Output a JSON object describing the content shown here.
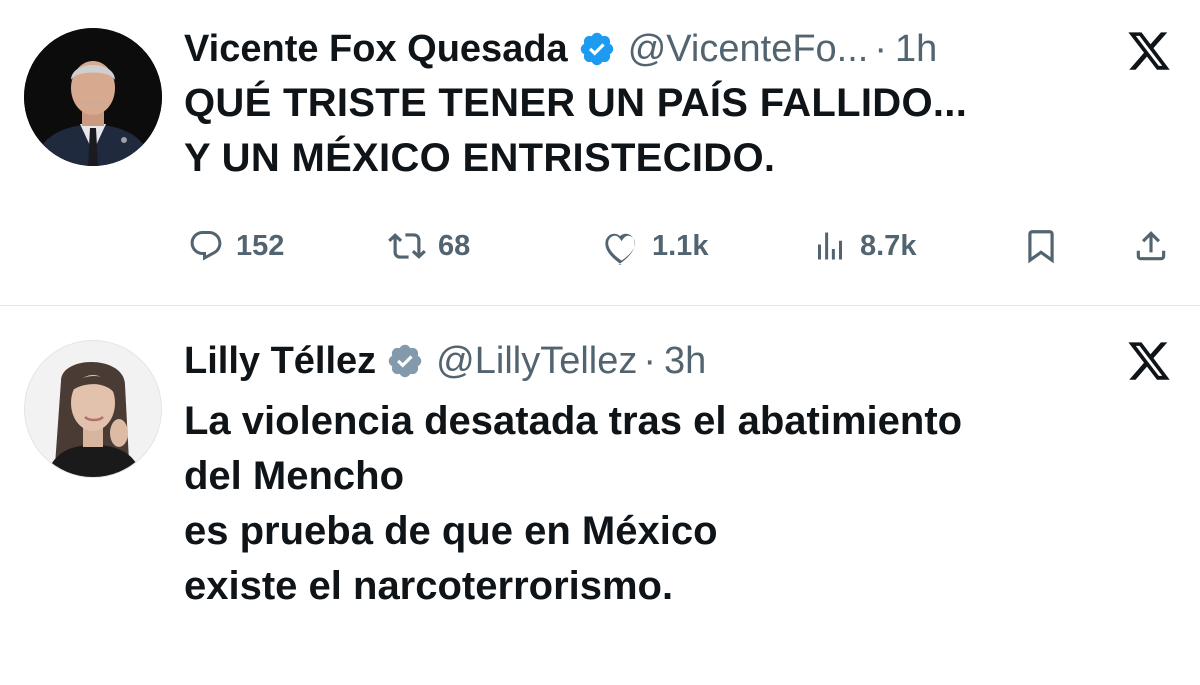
{
  "tweets": [
    {
      "author_name": "Vicente Fox Quesada",
      "handle": "@VicenteFo...",
      "separator": "·",
      "time": "1h",
      "text_lines": [
        "QUÉ TRISTE TENER UN PAÍS FALLIDO...",
        "Y UN MÉXICO ENTRISTECIDO."
      ],
      "verified_badge_color": "#1d9bf0",
      "stats": {
        "replies": "152",
        "reposts": "68",
        "likes": "1.1k",
        "views": "8.7k"
      }
    },
    {
      "author_name": "Lilly Téllez",
      "handle": "@LillyTellez",
      "separator": "·",
      "time": "3h",
      "text_lines": [
        "La violencia desatada tras el abatimiento",
        "del Mencho",
        "es prueba de que en México",
        "existe el narcoterrorismo."
      ],
      "verified_badge_color": "#829aab"
    }
  ],
  "icons": {
    "reply": "reply-icon",
    "repost": "repost-icon",
    "like": "like-icon",
    "views": "views-icon",
    "bookmark": "bookmark-icon",
    "share": "share-icon",
    "x_logo": "x-logo-icon",
    "verified": "verified-badge-icon"
  },
  "colors": {
    "text": "#0f1419",
    "secondary": "#536471",
    "divider": "#e3e6e8"
  }
}
